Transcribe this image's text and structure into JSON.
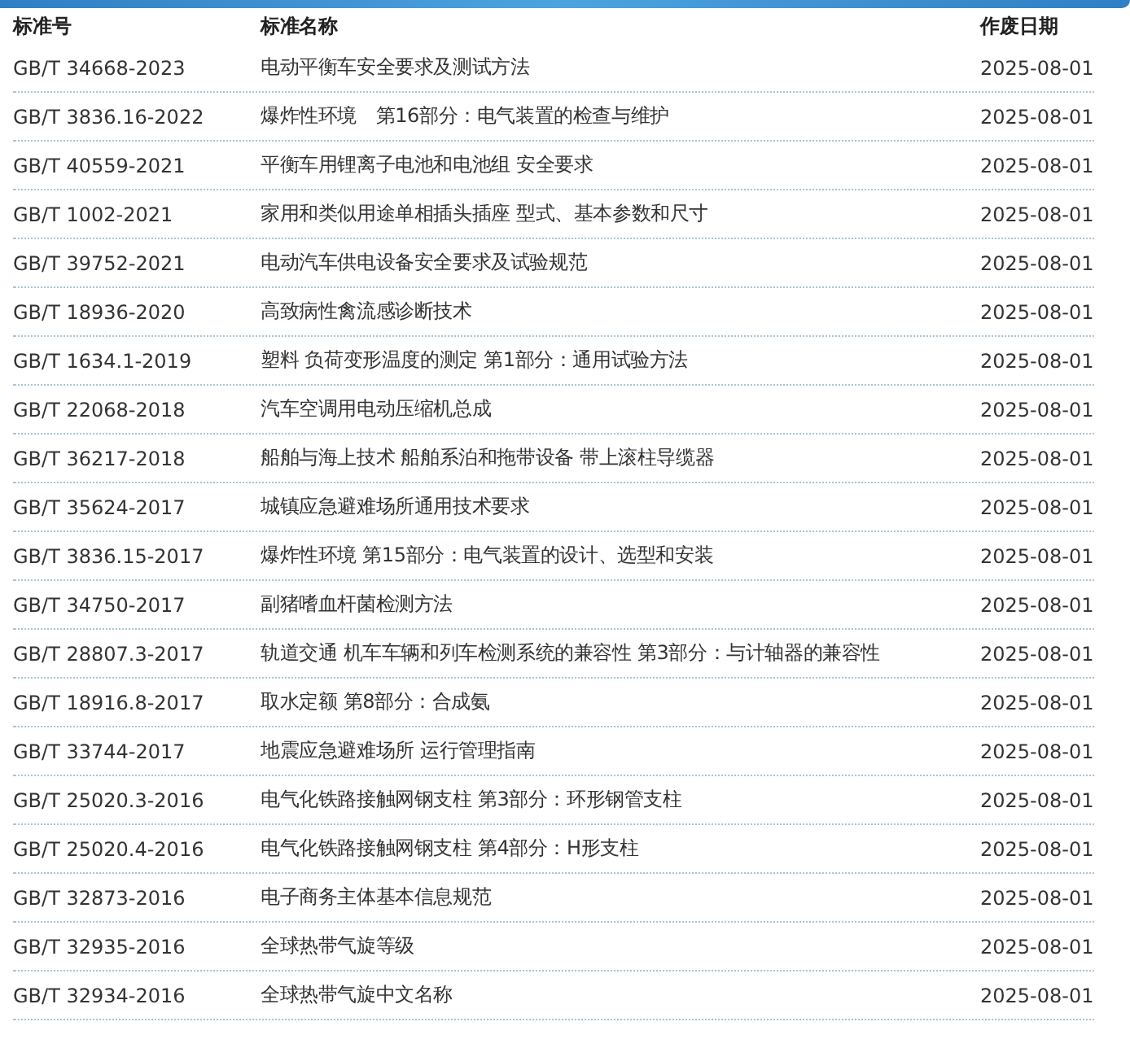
{
  "table": {
    "columns": [
      "标准号",
      "标准名称",
      "作废日期"
    ],
    "rows": [
      {
        "number": "GB/T 34668-2023",
        "name": "电动平衡车安全要求及测试方法",
        "date": "2025-08-01"
      },
      {
        "number": "GB/T 3836.16-2022",
        "name": "爆炸性环境　第16部分：电气装置的检查与维护",
        "date": "2025-08-01"
      },
      {
        "number": "GB/T 40559-2021",
        "name": "平衡车用锂离子电池和电池组 安全要求",
        "date": "2025-08-01"
      },
      {
        "number": "GB/T 1002-2021",
        "name": "家用和类似用途单相插头插座 型式、基本参数和尺寸",
        "date": "2025-08-01"
      },
      {
        "number": "GB/T 39752-2021",
        "name": "电动汽车供电设备安全要求及试验规范",
        "date": "2025-08-01"
      },
      {
        "number": "GB/T 18936-2020",
        "name": "高致病性禽流感诊断技术",
        "date": "2025-08-01"
      },
      {
        "number": "GB/T 1634.1-2019",
        "name": "塑料 负荷变形温度的测定 第1部分：通用试验方法",
        "date": "2025-08-01"
      },
      {
        "number": "GB/T 22068-2018",
        "name": "汽车空调用电动压缩机总成",
        "date": "2025-08-01"
      },
      {
        "number": "GB/T 36217-2018",
        "name": "船舶与海上技术 船舶系泊和拖带设备 带上滚柱导缆器",
        "date": "2025-08-01"
      },
      {
        "number": "GB/T 35624-2017",
        "name": "城镇应急避难场所通用技术要求",
        "date": "2025-08-01"
      },
      {
        "number": "GB/T 3836.15-2017",
        "name": "爆炸性环境 第15部分：电气装置的设计、选型和安装",
        "date": "2025-08-01"
      },
      {
        "number": "GB/T 34750-2017",
        "name": "副猪嗜血杆菌检测方法",
        "date": "2025-08-01"
      },
      {
        "number": "GB/T 28807.3-2017",
        "name": "轨道交通 机车车辆和列车检测系统的兼容性 第3部分：与计轴器的兼容性",
        "date": "2025-08-01"
      },
      {
        "number": "GB/T 18916.8-2017",
        "name": "取水定额 第8部分：合成氨",
        "date": "2025-08-01"
      },
      {
        "number": "GB/T 33744-2017",
        "name": "地震应急避难场所 运行管理指南",
        "date": "2025-08-01"
      },
      {
        "number": "GB/T 25020.3-2016",
        "name": "电气化铁路接触网钢支柱 第3部分：环形钢管支柱",
        "date": "2025-08-01"
      },
      {
        "number": "GB/T 25020.4-2016",
        "name": "电气化铁路接触网钢支柱 第4部分：H形支柱",
        "date": "2025-08-01"
      },
      {
        "number": "GB/T 32873-2016",
        "name": "电子商务主体基本信息规范",
        "date": "2025-08-01"
      },
      {
        "number": "GB/T 32935-2016",
        "name": "全球热带气旋等级",
        "date": "2025-08-01"
      },
      {
        "number": "GB/T 32934-2016",
        "name": "全球热带气旋中文名称",
        "date": "2025-08-01"
      }
    ]
  }
}
